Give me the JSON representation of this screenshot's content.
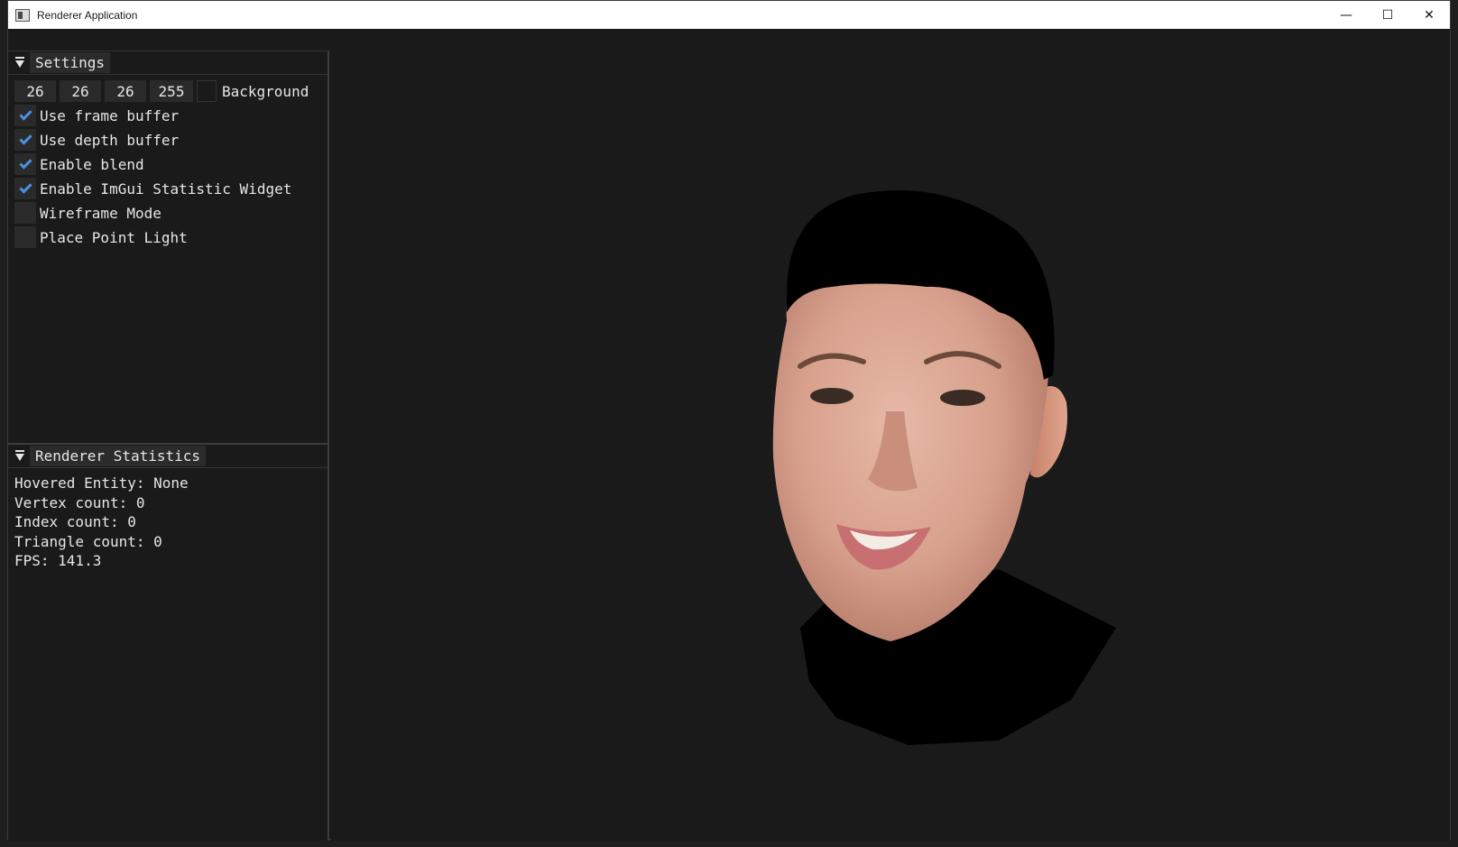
{
  "window": {
    "title": "Renderer Application"
  },
  "titlebar_buttons": {
    "minimize": "—",
    "maximize": "☐",
    "close": "✕"
  },
  "settings": {
    "header": "Settings",
    "background": {
      "r": "26",
      "g": "26",
      "b": "26",
      "a": "255",
      "label": "Background",
      "color": "#1a1a1a"
    },
    "checkboxes": [
      {
        "label": "Use frame buffer",
        "checked": true
      },
      {
        "label": "Use depth buffer",
        "checked": true
      },
      {
        "label": "Enable blend",
        "checked": true
      },
      {
        "label": "Enable ImGui Statistic Widget",
        "checked": true
      },
      {
        "label": "Wireframe Mode",
        "checked": false
      },
      {
        "label": "Place Point Light",
        "checked": false
      }
    ]
  },
  "stats": {
    "header": "Renderer Statistics",
    "lines": [
      "Hovered Entity: None",
      "Vertex count: 0",
      "Index count: 0",
      "Triangle count: 0",
      "FPS: 141.3"
    ]
  },
  "colors": {
    "accent": "#4a90e2",
    "panel_bg": "#1a1a1a",
    "field_bg": "#2a2a2a"
  }
}
